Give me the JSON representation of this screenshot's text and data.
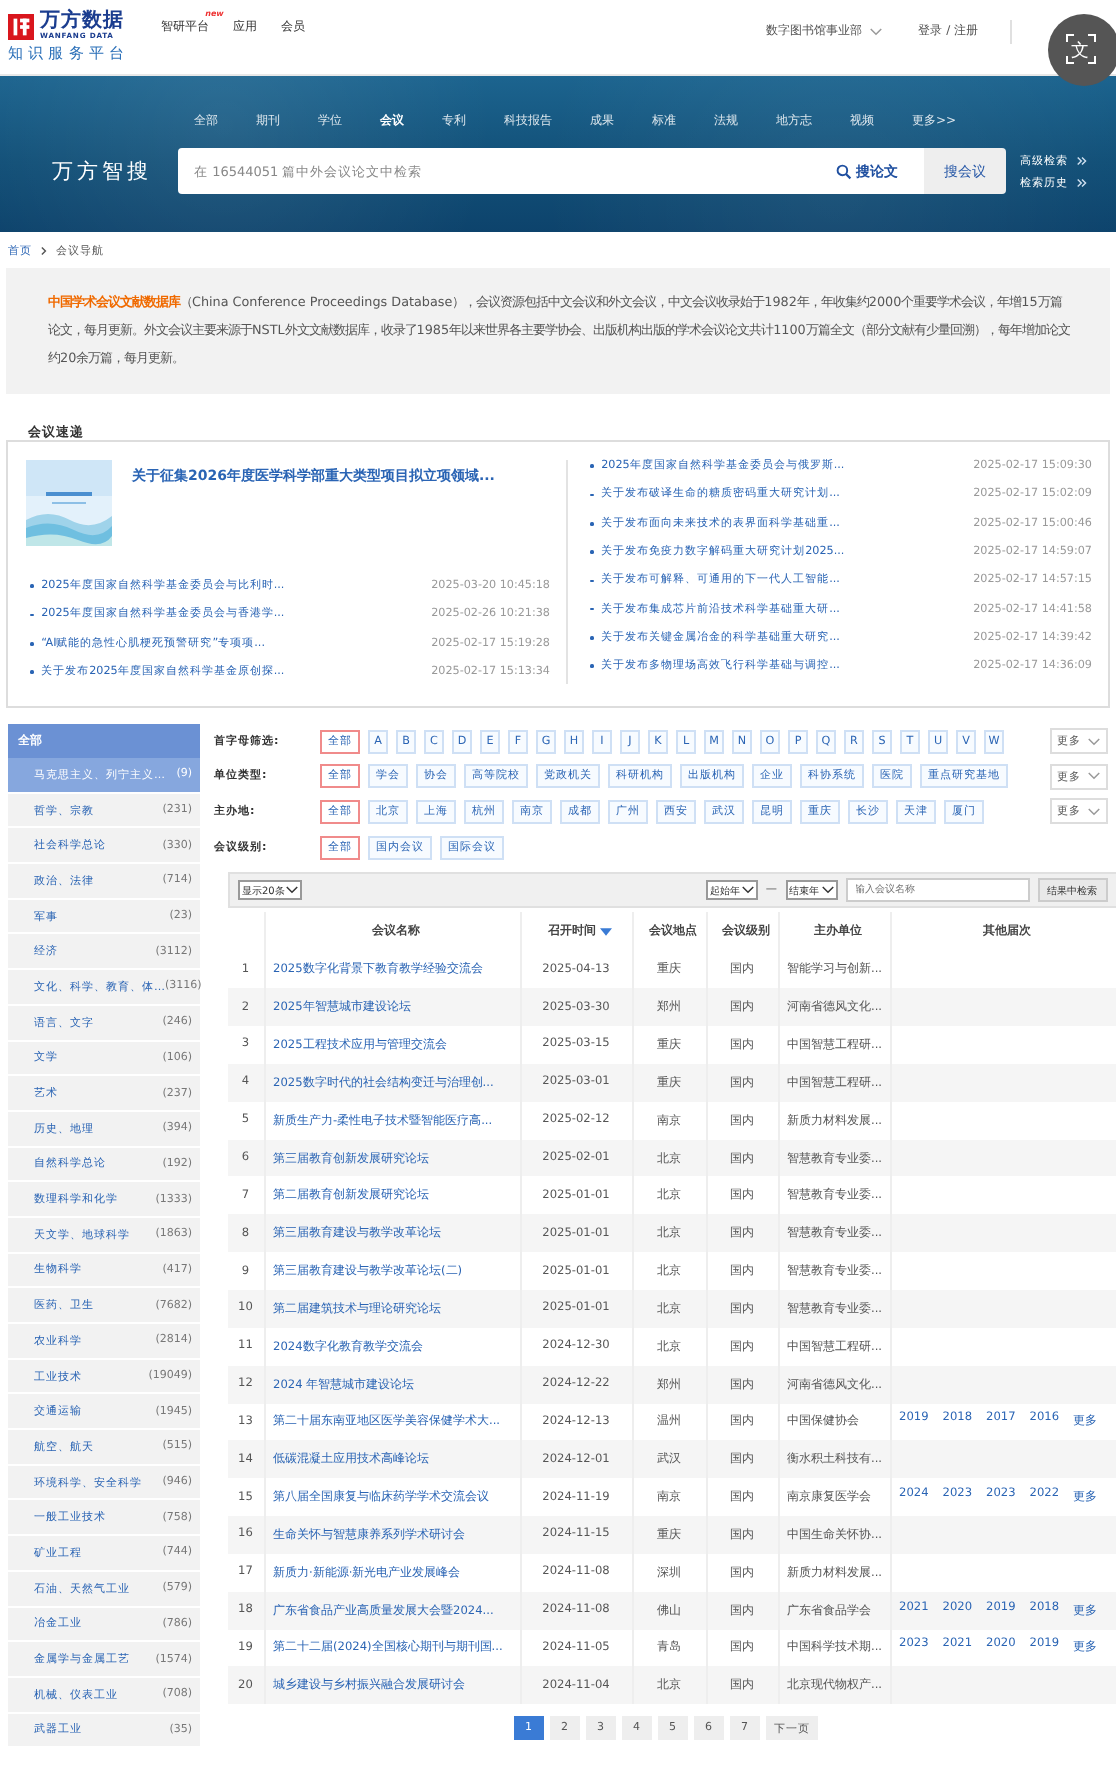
{
  "header": {
    "logo_title": "万方数据",
    "logo_subtitle": "WANFANG DATA",
    "platform": "知识服务平台",
    "nav": [
      {
        "label": "智研平台",
        "badge": "new"
      },
      {
        "label": "应用"
      },
      {
        "label": "会员"
      }
    ],
    "org": "数字图书馆事业部",
    "login": "登录 / 注册",
    "translate_button": "文"
  },
  "search": {
    "tabs": [
      {
        "label": "全部",
        "selected": false
      },
      {
        "label": "期刊",
        "selected": false
      },
      {
        "label": "学位",
        "selected": false
      },
      {
        "label": "会议",
        "selected": true
      },
      {
        "label": "专利",
        "selected": false
      },
      {
        "label": "科技报告",
        "selected": false
      },
      {
        "label": "成果",
        "selected": false
      },
      {
        "label": "标准",
        "selected": false
      },
      {
        "label": "法规",
        "selected": false
      },
      {
        "label": "地方志",
        "selected": false
      },
      {
        "label": "视频",
        "selected": false
      },
      {
        "label": "更多>>",
        "selected": false
      }
    ],
    "brand": "万方智搜",
    "placeholder": "在 16544051 篇中外会议论文中检索",
    "search_button": "搜论文",
    "alt_button": "搜会议",
    "links": [
      "高级检索",
      "检索历史"
    ]
  },
  "breadcrumb": [
    "首页",
    "会议导航"
  ],
  "intro": "**中国学术会议文献数据库**（China Conference Proceedings Database），会议资源包括中文会议和外文会议，中文会议收录始于1982年，年收集约2000个重要学术会议，年增15万篇论文，每月更新。外文会议主要来源于NSTL外文文献数据库，收录了1985年以来世界各主要学协会、出版机构出版的学术会议论文共计1100万篇全文（部分文献有少量回溯），每年增加论文约20余万篇，每月更新。",
  "news": {
    "title": "会议速递",
    "headline": "关于征集2026年度医学科学部重大类型项目拟立项领域...",
    "left": [
      {
        "title": "2025年度国家自然科学基金委员会与比利时...",
        "date": "2025-03-20 10:45:18"
      },
      {
        "title": "2025年度国家自然科学基金委员会与香港学...",
        "date": "2025-02-26 10:21:38"
      },
      {
        "title": "“AI赋能的急性心肌梗死预警研究”专项项...",
        "date": "2025-02-17 15:19:28"
      },
      {
        "title": "关于发布2025年度国家自然科学基金原创探...",
        "date": "2025-02-17 15:13:34"
      }
    ],
    "right": [
      {
        "title": "2025年度国家自然科学基金委员会与俄罗斯...",
        "date": "2025-02-17 15:09:30"
      },
      {
        "title": "关于发布破译生命的糖质密码重大研究计划...",
        "date": "2025-02-17 15:02:09"
      },
      {
        "title": "关于发布面向未来技术的表界面科学基础重...",
        "date": "2025-02-17 15:00:46"
      },
      {
        "title": "关于发布免疫力数字解码重大研究计划2025...",
        "date": "2025-02-17 14:59:07"
      },
      {
        "title": "关于发布可解释、可通用的下一代人工智能...",
        "date": "2025-02-17 14:57:15"
      },
      {
        "title": "关于发布集成芯片前沿技术科学基础重大研...",
        "date": "2025-02-17 14:41:58"
      },
      {
        "title": "关于发布关键金属冶金的科学基础重大研究...",
        "date": "2025-02-17 14:39:42"
      },
      {
        "title": "关于发布多物理场高效飞行科学基础与调控...",
        "date": "2025-02-17 14:36:09"
      }
    ]
  },
  "categories": {
    "header": "全部",
    "items": [
      {
        "name": "马克思主义、列宁主义…",
        "count": "(9)",
        "selected": true
      },
      {
        "name": "哲学、宗教",
        "count": "(231)",
        "selected": false
      },
      {
        "name": "社会科学总论",
        "count": "(330)",
        "selected": false
      },
      {
        "name": "政治、法律",
        "count": "(714)",
        "selected": false
      },
      {
        "name": "军事",
        "count": "(23)",
        "selected": false
      },
      {
        "name": "经济",
        "count": "(3112)",
        "selected": false
      },
      {
        "name": "文化、科学、教育、体…",
        "count": "(3116)",
        "selected": false
      },
      {
        "name": "语言、文字",
        "count": "(246)",
        "selected": false
      },
      {
        "name": "文学",
        "count": "(106)",
        "selected": false
      },
      {
        "name": "艺术",
        "count": "(237)",
        "selected": false
      },
      {
        "name": "历史、地理",
        "count": "(394)",
        "selected": false
      },
      {
        "name": "自然科学总论",
        "count": "(192)",
        "selected": false
      },
      {
        "name": "数理科学和化学",
        "count": "(1333)",
        "selected": false
      },
      {
        "name": "天文学、地球科学",
        "count": "(1863)",
        "selected": false
      },
      {
        "name": "生物科学",
        "count": "(417)",
        "selected": false
      },
      {
        "name": "医药、卫生",
        "count": "(7682)",
        "selected": false
      },
      {
        "name": "农业科学",
        "count": "(2814)",
        "selected": false
      },
      {
        "name": "工业技术",
        "count": "(19049)",
        "selected": false
      },
      {
        "name": "交通运输",
        "count": "(1945)",
        "selected": false
      },
      {
        "name": "航空、航天",
        "count": "(515)",
        "selected": false
      },
      {
        "name": "环境科学、安全科学",
        "count": "(946)",
        "selected": false
      },
      {
        "name": "一般工业技术",
        "count": "(758)",
        "selected": false
      },
      {
        "name": "矿业工程",
        "count": "(744)",
        "selected": false
      },
      {
        "name": "石油、天然气工业",
        "count": "(579)",
        "selected": false
      },
      {
        "name": "冶金工业",
        "count": "(786)",
        "selected": false
      },
      {
        "name": "金属学与金属工艺",
        "count": "(1574)",
        "selected": false
      },
      {
        "name": "机械、仪表工业",
        "count": "(708)",
        "selected": false
      },
      {
        "name": "武器工业",
        "count": "(35)",
        "selected": false
      }
    ]
  },
  "filters": [
    {
      "label": "首字母筛选:",
      "kind": "letters",
      "more": "更多",
      "options": [
        {
          "label": "全部",
          "selected": true
        },
        {
          "label": "A",
          "selected": false
        },
        {
          "label": "B",
          "selected": false
        },
        {
          "label": "C",
          "selected": false
        },
        {
          "label": "D",
          "selected": false
        },
        {
          "label": "E",
          "selected": false
        },
        {
          "label": "F",
          "selected": false
        },
        {
          "label": "G",
          "selected": false
        },
        {
          "label": "H",
          "selected": false
        },
        {
          "label": "I",
          "selected": false
        },
        {
          "label": "J",
          "selected": false
        },
        {
          "label": "K",
          "selected": false
        },
        {
          "label": "L",
          "selected": false
        },
        {
          "label": "M",
          "selected": false
        },
        {
          "label": "N",
          "selected": false
        },
        {
          "label": "O",
          "selected": false
        },
        {
          "label": "P",
          "selected": false
        },
        {
          "label": "Q",
          "selected": false
        },
        {
          "label": "R",
          "selected": false
        },
        {
          "label": "S",
          "selected": false
        },
        {
          "label": "T",
          "selected": false
        },
        {
          "label": "U",
          "selected": false
        },
        {
          "label": "V",
          "selected": false
        },
        {
          "label": "W",
          "selected": false
        }
      ]
    },
    {
      "label": "单位类型:",
      "kind": "words",
      "more": "更多",
      "options": [
        {
          "label": "全部",
          "selected": true
        },
        {
          "label": "学会",
          "selected": false
        },
        {
          "label": "协会",
          "selected": false
        },
        {
          "label": "高等院校",
          "selected": false
        },
        {
          "label": "党政机关",
          "selected": false
        },
        {
          "label": "科研机构",
          "selected": false
        },
        {
          "label": "出版机构",
          "selected": false
        },
        {
          "label": "企业",
          "selected": false
        },
        {
          "label": "科协系统",
          "selected": false
        },
        {
          "label": "医院",
          "selected": false
        },
        {
          "label": "重点研究基地",
          "selected": false
        }
      ]
    },
    {
      "label": "主办地:",
      "kind": "places",
      "more": "更多",
      "options": [
        {
          "label": "全部",
          "selected": true
        },
        {
          "label": "北京",
          "selected": false
        },
        {
          "label": "上海",
          "selected": false
        },
        {
          "label": "杭州",
          "selected": false
        },
        {
          "label": "南京",
          "selected": false
        },
        {
          "label": "成都",
          "selected": false
        },
        {
          "label": "广州",
          "selected": false
        },
        {
          "label": "西安",
          "selected": false
        },
        {
          "label": "武汉",
          "selected": false
        },
        {
          "label": "昆明",
          "selected": false
        },
        {
          "label": "重庆",
          "selected": false
        },
        {
          "label": "长沙",
          "selected": false
        },
        {
          "label": "天津",
          "selected": false
        },
        {
          "label": "厦门",
          "selected": false
        }
      ]
    },
    {
      "label": "会议级别:",
      "kind": "words",
      "options": [
        {
          "label": "全部",
          "selected": true
        },
        {
          "label": "国内会议",
          "selected": false
        },
        {
          "label": "国际会议",
          "selected": false
        }
      ]
    }
  ],
  "toolbar": {
    "page_size": "显示20条",
    "start_year": "起始年",
    "dash": "—",
    "end_year": "结束年",
    "placeholder": "输入会议名称",
    "button": "结果中检索"
  },
  "table": {
    "columns": [
      {
        "label": "会议名称",
        "sorted": false
      },
      {
        "label": "召开时间",
        "sorted": true
      },
      {
        "label": "会议地点",
        "sorted": false
      },
      {
        "label": "会议级别",
        "sorted": false
      },
      {
        "label": "主办单位",
        "sorted": false
      },
      {
        "label": "其他届次",
        "sorted": false
      }
    ],
    "rows": [
      {
        "no": "1",
        "name": "2025数字化背景下教育教学经验交流会",
        "date": "2025-04-13",
        "place": "重庆",
        "level": "国内",
        "org": "智能学习与创新..."
      },
      {
        "no": "2",
        "name": "2025年智慧城市建设论坛",
        "date": "2025-03-30",
        "place": "郑州",
        "level": "国内",
        "org": "河南省德风文化..."
      },
      {
        "no": "3",
        "name": "2025工程技术应用与管理交流会",
        "date": "2025-03-15",
        "place": "重庆",
        "level": "国内",
        "org": "中国智慧工程研..."
      },
      {
        "no": "4",
        "name": "2025数字时代的社会结构变迁与治理创...",
        "date": "2025-03-01",
        "place": "重庆",
        "level": "国内",
        "org": "中国智慧工程研..."
      },
      {
        "no": "5",
        "name": "新质生产力-柔性电子技术暨智能医疗高...",
        "date": "2025-02-12",
        "place": "南京",
        "level": "国内",
        "org": "新质力材料发展..."
      },
      {
        "no": "6",
        "name": "第三届教育创新发展研究论坛",
        "date": "2025-02-01",
        "place": "北京",
        "level": "国内",
        "org": "智慧教育专业委..."
      },
      {
        "no": "7",
        "name": "第二届教育创新发展研究论坛",
        "date": "2025-01-01",
        "place": "北京",
        "level": "国内",
        "org": "智慧教育专业委..."
      },
      {
        "no": "8",
        "name": "第三届教育建设与教学改革论坛",
        "date": "2025-01-01",
        "place": "北京",
        "level": "国内",
        "org": "智慧教育专业委..."
      },
      {
        "no": "9",
        "name": "第三届教育建设与教学改革论坛(二)",
        "date": "2025-01-01",
        "place": "北京",
        "level": "国内",
        "org": "智慧教育专业委..."
      },
      {
        "no": "10",
        "name": "第二届建筑技术与理论研究论坛",
        "date": "2025-01-01",
        "place": "北京",
        "level": "国内",
        "org": "智慧教育专业委..."
      },
      {
        "no": "11",
        "name": "2024数字化教育教学交流会",
        "date": "2024-12-30",
        "place": "北京",
        "level": "国内",
        "org": "中国智慧工程研..."
      },
      {
        "no": "12",
        "name": "2024 年智慧城市建设论坛",
        "date": "2024-12-22",
        "place": "郑州",
        "level": "国内",
        "org": "河南省德风文化..."
      },
      {
        "no": "13",
        "name": "第二十届东南亚地区医学美容保健学术大...",
        "date": "2024-12-13",
        "place": "温州",
        "level": "国内",
        "org": "中国保健协会",
        "other": [
          "2019",
          "2018",
          "2017",
          "2016",
          "更多"
        ]
      },
      {
        "no": "14",
        "name": "低碳混凝土应用技术高峰论坛",
        "date": "2024-12-01",
        "place": "武汉",
        "level": "国内",
        "org": "衡水积土科技有..."
      },
      {
        "no": "15",
        "name": "第八届全国康复与临床药学学术交流会议",
        "date": "2024-11-19",
        "place": "南京",
        "level": "国内",
        "org": "南京康复医学会",
        "other": [
          "2024",
          "2023",
          "2023",
          "2022",
          "更多"
        ]
      },
      {
        "no": "16",
        "name": "生命关怀与智慧康养系列学术研讨会",
        "date": "2024-11-15",
        "place": "重庆",
        "level": "国内",
        "org": "中国生命关怀协..."
      },
      {
        "no": "17",
        "name": "新质力·新能源·新光电产业发展峰会",
        "date": "2024-11-08",
        "place": "深圳",
        "level": "国内",
        "org": "新质力材料发展..."
      },
      {
        "no": "18",
        "name": "广东省食品产业高质量发展大会暨2024...",
        "date": "2024-11-08",
        "place": "佛山",
        "level": "国内",
        "org": "广东省食品学会",
        "other": [
          "2021",
          "2020",
          "2019",
          "2018",
          "更多"
        ]
      },
      {
        "no": "19",
        "name": "第二十二届(2024)全国核心期刊与期刊国...",
        "date": "2024-11-05",
        "place": "青岛",
        "level": "国内",
        "org": "中国科学技术期...",
        "other": [
          "2023",
          "2021",
          "2020",
          "2019",
          "更多"
        ]
      },
      {
        "no": "20",
        "name": "城乡建设与乡村振兴融合发展研讨会",
        "date": "2024-11-04",
        "place": "北京",
        "level": "国内",
        "org": "北京现代物权产..."
      }
    ]
  },
  "pagination": {
    "pages": [
      {
        "label": "1",
        "selected": true
      },
      {
        "label": "2",
        "selected": false
      },
      {
        "label": "3",
        "selected": false
      },
      {
        "label": "4",
        "selected": false
      },
      {
        "label": "5",
        "selected": false
      },
      {
        "label": "6",
        "selected": false
      },
      {
        "label": "7",
        "selected": false
      }
    ],
    "next": "下一页"
  }
}
